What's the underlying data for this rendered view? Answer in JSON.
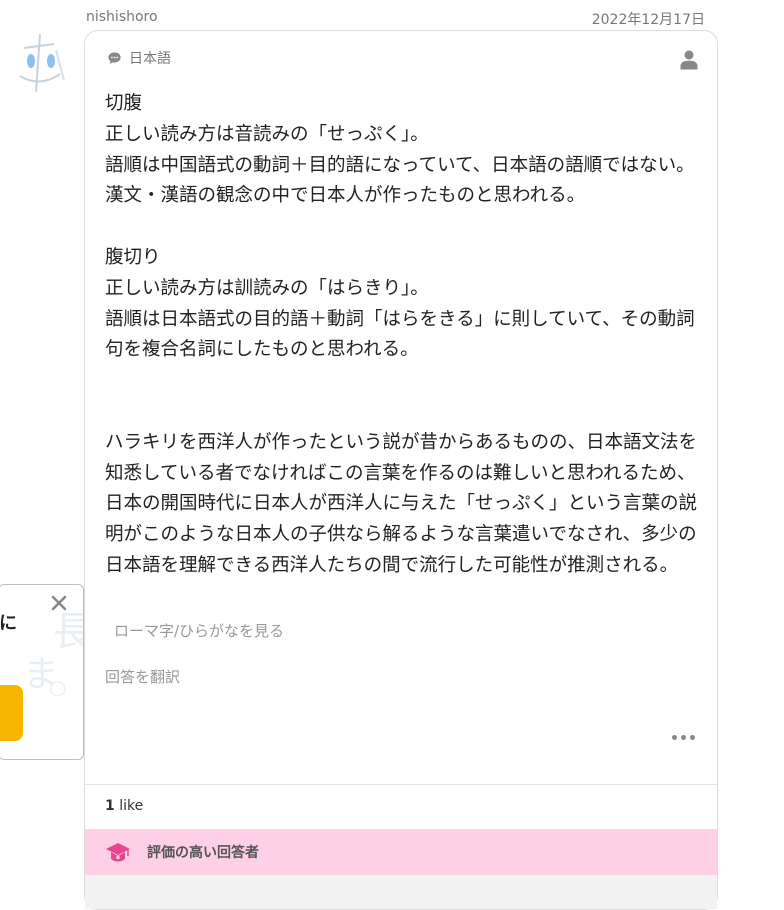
{
  "header": {
    "username": "nishishoro",
    "date": "2022年12月17日"
  },
  "answer": {
    "language": "日本語",
    "paragraphs": [
      "切腹",
      "正しい読み方は音読みの「せっぷく」。",
      "語順は中国語式の動詞＋目的語になっていて、日本語の語順ではない。漢文・漢語の観念の中で日本人が作ったものと思われる。",
      "腹切り",
      "正しい読み方は訓読みの「はらきり」。",
      "語順は日本語式の目的語＋動詞「はらをきる」に則していて、その動詞句を複合名詞にしたものと思われる。",
      "ハラキリを西洋人が作ったという説が昔からあるものの、日本語文法を知悉している者でなければこの言葉を作るのは難しいと思われるため、日本の開国時代に日本人が西洋人に与えた「せっぷく」という言葉の説明がこのような日本人の子供なら解るような言葉遣いでなされ、多少の日本語を理解できる西洋人たちの間で流行した可能性が推測される。"
    ],
    "romaji_link": "ローマ字/ひらがなを見る",
    "translate_link": "回答を翻訳"
  },
  "likes": {
    "count": "1",
    "label": "like"
  },
  "badge": {
    "label": "評価の高い回答者"
  },
  "popup": {
    "text": "に"
  },
  "colors": {
    "badge_bg": "#fdd0e6",
    "badge_icon": "#e8458f",
    "popup_button": "#f7b500"
  }
}
